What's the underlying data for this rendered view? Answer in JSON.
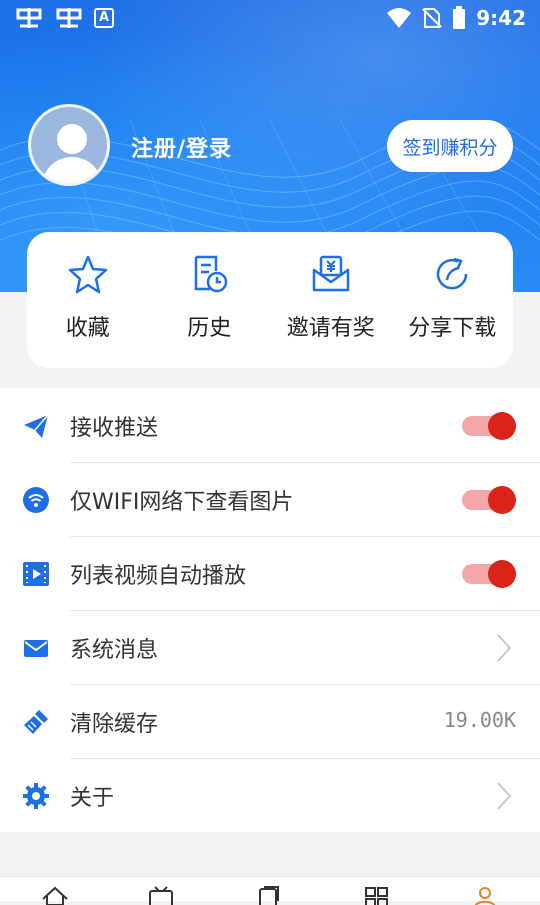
{
  "status_bar": {
    "time": "9:42",
    "app_badge": "A"
  },
  "profile": {
    "login_text": "注册/登录",
    "signin_button": "签到赚积分"
  },
  "quick_actions": [
    {
      "label": "收藏",
      "icon": "star-icon"
    },
    {
      "label": "历史",
      "icon": "history-icon"
    },
    {
      "label": "邀请有奖",
      "icon": "invite-reward-icon"
    },
    {
      "label": "分享下载",
      "icon": "share-icon"
    }
  ],
  "settings": {
    "push": {
      "label": "接收推送",
      "enabled": true
    },
    "wifi_images": {
      "label": "仅WIFI网络下查看图片",
      "enabled": true
    },
    "autoplay": {
      "label": "列表视频自动播放",
      "enabled": true
    },
    "messages": {
      "label": "系统消息"
    },
    "clear_cache": {
      "label": "清除缓存",
      "value": "19.00K"
    },
    "about": {
      "label": "关于"
    }
  },
  "colors": {
    "primary": "#1e6fe6",
    "toggle_on": "#d9231b",
    "toggle_track": "#f2a8a8"
  }
}
